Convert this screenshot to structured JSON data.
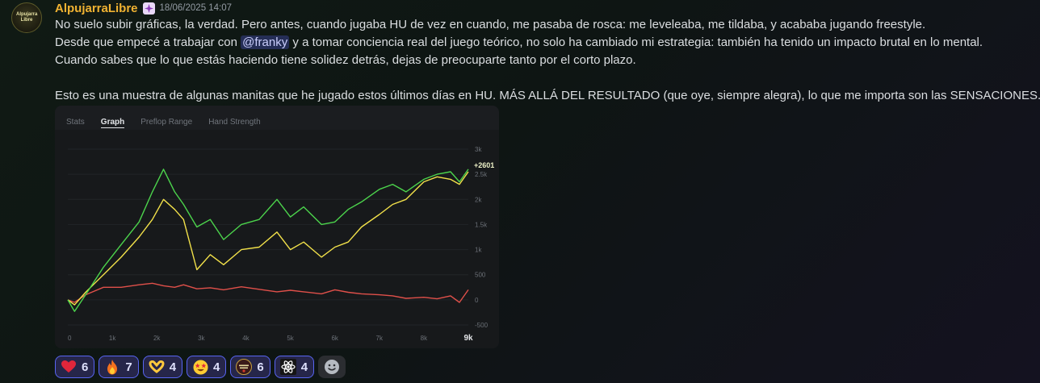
{
  "author": {
    "name": "AlpujarraLibre",
    "avatar_text": "Alpujarra Libre"
  },
  "timestamp": "18/06/2025 14:07",
  "message": {
    "line1": "No suelo subir gráficas, la verdad. Pero antes, cuando jugaba HU de vez en cuando, me pasaba de rosca: me leveleaba, me tildaba, y acababa jugando freestyle.",
    "line2_before": "Desde que empecé a trabajar con ",
    "mention": "@franky",
    "line2_after": " y a tomar conciencia real del juego teórico, no solo ha cambiado mi estrategia: también ha tenido un impacto brutal en lo mental.",
    "line3": "Cuando sabes que lo que estás haciendo tiene solidez detrás, dejas de preocuparte tanto por el corto plazo.",
    "line5": "Esto es una muestra de algunas manitas que he jugado estos últimos días en HU. MÁS ALLÁ DEL RESULTADO (que oye, siempre alegra), lo que me importa son las SENSACIONES."
  },
  "embed": {
    "tabs": [
      {
        "label": "Stats",
        "active": false
      },
      {
        "label": "Graph",
        "active": true
      },
      {
        "label": "Preflop Range",
        "active": false
      },
      {
        "label": "Hand Strength",
        "active": false
      }
    ]
  },
  "chart_data": {
    "type": "line",
    "x_ticks": [
      "0",
      "1k",
      "2k",
      "3k",
      "4k",
      "5k",
      "6k",
      "7k",
      "8k",
      "9k"
    ],
    "y_ticks": [
      "3k",
      "2.5k",
      "2k",
      "1.5k",
      "1k",
      "500",
      "0",
      "-500"
    ],
    "xlim": [
      0,
      9000
    ],
    "ylim": [
      -500,
      3000
    ],
    "end_label": "+2601",
    "x": [
      0,
      150,
      400,
      800,
      1200,
      1600,
      1900,
      2150,
      2400,
      2600,
      2900,
      3200,
      3500,
      3900,
      4300,
      4700,
      5000,
      5300,
      5700,
      6000,
      6300,
      6600,
      7000,
      7300,
      7600,
      8000,
      8300,
      8600,
      8800,
      9000
    ],
    "series": [
      {
        "color": "#4cd44c",
        "values": [
          0,
          -230,
          100,
          650,
          1100,
          1550,
          2150,
          2600,
          2150,
          1900,
          1450,
          1600,
          1200,
          1500,
          1600,
          2000,
          1650,
          1850,
          1500,
          1550,
          1800,
          1950,
          2200,
          2300,
          2150,
          2400,
          2500,
          2550,
          2350,
          2601
        ]
      },
      {
        "color": "#f2e14a",
        "values": [
          0,
          -100,
          150,
          500,
          850,
          1250,
          1600,
          2000,
          1800,
          1600,
          600,
          900,
          700,
          1000,
          1050,
          1350,
          1000,
          1150,
          850,
          1050,
          1150,
          1450,
          1700,
          1900,
          2000,
          2350,
          2450,
          2400,
          2300,
          2550
        ]
      },
      {
        "color": "#e0504a",
        "values": [
          0,
          -50,
          100,
          250,
          250,
          300,
          330,
          280,
          250,
          300,
          220,
          240,
          200,
          260,
          210,
          160,
          190,
          160,
          120,
          200,
          150,
          120,
          100,
          80,
          30,
          50,
          20,
          80,
          -50,
          200
        ]
      }
    ]
  },
  "reactions": [
    {
      "emoji": "heart-emoji",
      "count": "6"
    },
    {
      "emoji": "fire-emoji",
      "count": "7"
    },
    {
      "emoji": "heart-hands-emoji",
      "count": "4"
    },
    {
      "emoji": "star-struck-emoji",
      "count": "4"
    },
    {
      "emoji": "alpujarra-logo-emoji",
      "count": "6"
    },
    {
      "emoji": "atom-emoji",
      "count": "4"
    }
  ]
}
